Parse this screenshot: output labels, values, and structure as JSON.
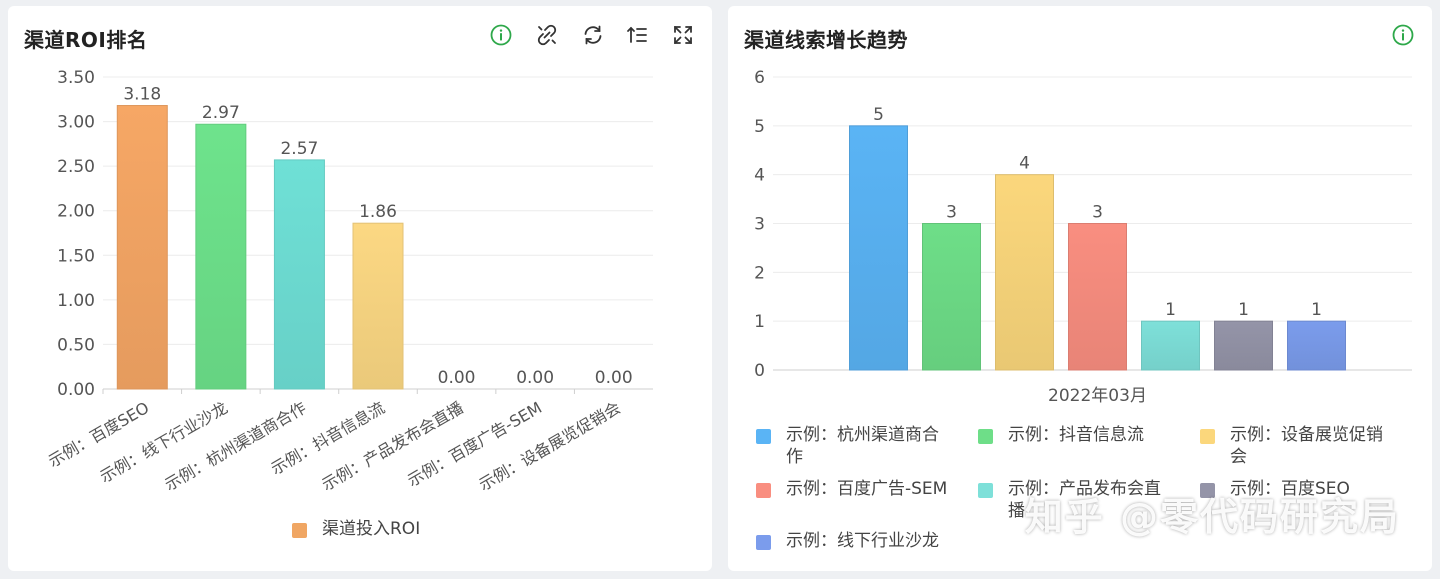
{
  "colors": {
    "info_icon": "#2ea84a",
    "tool_icon": "#333333",
    "axis_text": "#555555",
    "grid": "#e6e6e6"
  },
  "left_panel": {
    "title": "渠道ROI排名",
    "toolbar": [
      "info-icon",
      "unlink-icon",
      "refresh-icon",
      "sort-icon",
      "fullscreen-icon"
    ]
  },
  "right_panel": {
    "title": "渠道线索增长趋势",
    "toolbar": [
      "info-icon"
    ]
  },
  "watermark": "知乎 @零代码研究局",
  "chart_data": [
    {
      "type": "bar",
      "categories": [
        "示例：百度SEO",
        "示例：线下行业沙龙",
        "示例：杭州渠道商合作",
        "示例：抖音信息流",
        "示例：产品发布会直播",
        "示例：百度广告-SEM",
        "示例：设备展览促销会"
      ],
      "values": [
        3.18,
        2.97,
        2.57,
        1.86,
        0.0,
        0.0,
        0.0
      ],
      "data_labels": [
        "3.18",
        "2.97",
        "2.57",
        "1.86",
        "0.00",
        "0.00",
        "0.00"
      ],
      "bar_colors": [
        "#f6a765",
        "#6ee38c",
        "#6fe0d6",
        "#fcd883",
        "#fcd883",
        "#fcd883",
        "#fcd883"
      ],
      "ylim": [
        0,
        3.5
      ],
      "yticks": [
        "0.00",
        "0.50",
        "1.00",
        "1.50",
        "2.00",
        "2.50",
        "3.00",
        "3.50"
      ],
      "series": [
        {
          "name": "渠道投入ROI",
          "color": "#f0a663"
        }
      ],
      "grid": true,
      "legend_position": "bottom"
    },
    {
      "type": "bar",
      "categories": [
        "2022年03月"
      ],
      "series": [
        {
          "name": "示例：杭州渠道商合作",
          "values": [
            5
          ],
          "color": "#5ab4f5"
        },
        {
          "name": "示例：抖音信息流",
          "values": [
            3
          ],
          "color": "#6ede88"
        },
        {
          "name": "示例：设备展览促销会",
          "values": [
            4
          ],
          "color": "#fbd77c"
        },
        {
          "name": "示例：百度广告-SEM",
          "values": [
            3
          ],
          "color": "#f98e80"
        },
        {
          "name": "示例：产品发布会直播",
          "values": [
            1
          ],
          "color": "#7ee0d9"
        },
        {
          "name": "示例：百度SEO",
          "values": [
            1
          ],
          "color": "#9494a8"
        },
        {
          "name": "示例：线下行业沙龙",
          "values": [
            1
          ],
          "color": "#7b9cec"
        }
      ],
      "legend_texts": [
        "示例：杭州渠道商合\n作",
        "示例：抖音信息流",
        "示例：设备展览促销\n会",
        "示例：百度广告-SEM",
        "示例：产品发布会直\n播",
        "示例：百度SEO",
        "示例：线下行业沙龙"
      ],
      "ylim": [
        0,
        6
      ],
      "yticks": [
        "0",
        "1",
        "2",
        "3",
        "4",
        "5",
        "6"
      ],
      "grid": true,
      "legend_position": "bottom"
    }
  ]
}
